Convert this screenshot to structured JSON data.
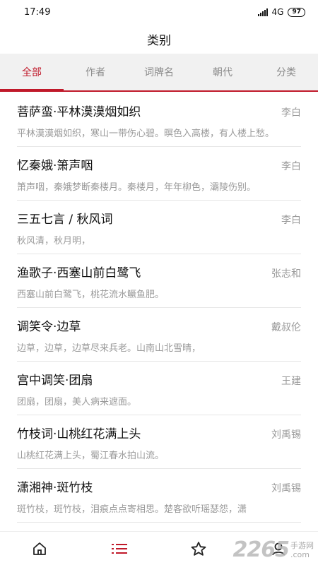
{
  "status": {
    "time": "17:49",
    "network": "4G",
    "battery": "97"
  },
  "header": {
    "title": "类别"
  },
  "tabs": [
    {
      "label": "全部",
      "active": true
    },
    {
      "label": "作者",
      "active": false
    },
    {
      "label": "词牌名",
      "active": false
    },
    {
      "label": "朝代",
      "active": false
    },
    {
      "label": "分类",
      "active": false
    }
  ],
  "poems": [
    {
      "title": "菩萨蛮·平林漠漠烟如织",
      "author": "李白",
      "excerpt": "平林漠漠烟如织，寒山一带伤心碧。暝色入高楼，有人楼上愁。"
    },
    {
      "title": "忆秦娥·箫声咽",
      "author": "李白",
      "excerpt": "箫声咽，秦娥梦断秦楼月。秦楼月，年年柳色，灞陵伤别。"
    },
    {
      "title": "三五七言 / 秋风词",
      "author": "李白",
      "excerpt": "秋风清，秋月明，"
    },
    {
      "title": "渔歌子·西塞山前白鹭飞",
      "author": "张志和",
      "excerpt": "西塞山前白鹭飞，桃花流水鳜鱼肥。"
    },
    {
      "title": "调笑令·边草",
      "author": "戴叔伦",
      "excerpt": "边草，边草，边草尽来兵老。山南山北雪晴，"
    },
    {
      "title": "宫中调笑·团扇",
      "author": "王建",
      "excerpt": "团扇，团扇，美人病来遮面。"
    },
    {
      "title": "竹枝词·山桃红花满上头",
      "author": "刘禹锡",
      "excerpt": "山桃红花满上头，蜀江春水拍山流。"
    },
    {
      "title": "潇湘神·斑竹枝",
      "author": "刘禹锡",
      "excerpt": "斑竹枝，斑竹枝，泪痕点点寄相思。楚客欲听瑶瑟怨，潇"
    }
  ],
  "bottom_nav": [
    {
      "icon": "home-icon",
      "active": false
    },
    {
      "icon": "list-icon",
      "active": true
    },
    {
      "icon": "star-icon",
      "active": false
    },
    {
      "icon": "user-icon",
      "active": false
    }
  ],
  "watermark": {
    "number": "2265",
    "text": "手游网",
    "domain": ".com"
  },
  "colors": {
    "accent": "#c0192a",
    "tab_bg": "#f1f1f1",
    "muted": "#9a9a9a"
  }
}
